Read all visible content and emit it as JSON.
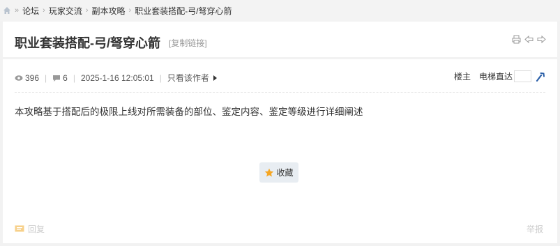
{
  "breadcrumb": {
    "items": [
      "论坛",
      "玩家交流",
      "副本攻略",
      "职业套装搭配-弓/弩穿心箭"
    ]
  },
  "post": {
    "title": "职业套装搭配-弓/弩穿心箭",
    "copy_link": "[复制链接]",
    "views": "396",
    "replies": "6",
    "datetime": "2025-1-16 12:05:01",
    "author_only": "只看该作者",
    "floor_owner": "楼主",
    "elevator": "电梯直达",
    "content": "本攻略基于搭配后的极限上线对所需装备的部位、鉴定内容、鉴定等级进行详细阐述",
    "favorite": "收藏",
    "reply": "回复",
    "report": "举报"
  },
  "icons": {
    "home": "home-icon",
    "views": "eye-icon",
    "replies": "comment-icon",
    "print": "print-icon",
    "prev": "prev-arrow-icon",
    "next": "next-arrow-icon",
    "go": "go-icon",
    "favorite": "star-icon",
    "reply": "reply-icon"
  },
  "colors": {
    "accent": "#2b5fa8",
    "star": "#f5a623",
    "reply_icon": "#f7d08a"
  }
}
